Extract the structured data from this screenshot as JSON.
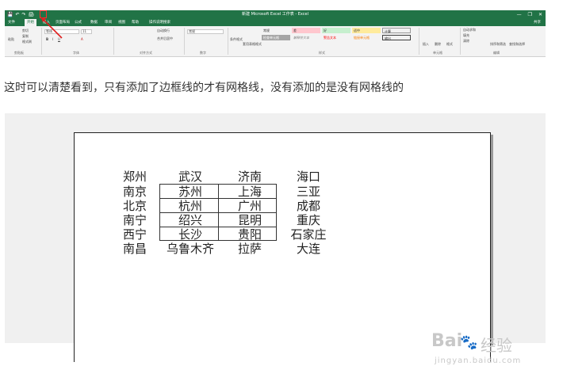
{
  "excel": {
    "window_title": "新建 Microsoft Excel 工作表 - Excel",
    "qat": {
      "save_icon": "💾",
      "undo_icon": "↶",
      "redo_icon": "↷",
      "print_preview_icon": "🖨"
    },
    "window_controls": [
      "—",
      "❐",
      "✕"
    ],
    "tabs": [
      "文件",
      "开始",
      "插入",
      "页面布局",
      "公式",
      "数据",
      "审阅",
      "视图",
      "帮助",
      "操作说明搜索"
    ],
    "active_tab_index": 1,
    "share": "共享",
    "groups": {
      "clipboard": {
        "label": "剪贴板",
        "paste": "粘贴",
        "cut": "剪切",
        "copy": "复制",
        "format_painter": "格式刷"
      },
      "font": {
        "label": "字体",
        "font_name": "等线",
        "font_size": "11"
      },
      "alignment": {
        "label": "对齐方式",
        "wrap": "自动换行",
        "merge": "合并后居中"
      },
      "number": {
        "label": "数字",
        "format": "常规"
      },
      "styles": {
        "label": "样式",
        "conditional": "条件格式",
        "table_format": "套用表格格式",
        "cells": [
          {
            "text": "常规",
            "bg": "#ffffff"
          },
          {
            "text": "差",
            "bg": "#ffc7ce"
          },
          {
            "text": "好",
            "bg": "#c6efce"
          },
          {
            "text": "适中",
            "bg": "#ffeb9c"
          },
          {
            "text": "计算",
            "bg": "#f2f2f2"
          },
          {
            "text": "检查单元格",
            "bg": "#a5a5a5"
          },
          {
            "text": "解释性文本",
            "bg": "#ffffff"
          },
          {
            "text": "警告文本",
            "bg": "#ffffff"
          },
          {
            "text": "链接单元格",
            "bg": "#ffffff"
          },
          {
            "text": "输出",
            "bg": "#f2f2f2"
          }
        ]
      },
      "cells": {
        "label": "单元格",
        "insert": "插入",
        "delete": "删除",
        "format": "格式"
      },
      "editing": {
        "label": "编辑",
        "autosum": "自动求和",
        "fill": "填充",
        "clear": "清除",
        "sort": "排序和筛选",
        "find": "查找和选择"
      }
    },
    "accent": "#217346"
  },
  "instruction": "这时可以清楚看到，只有添加了边框线的才有网格线，没有添加的是没有网格线的",
  "preview": {
    "rows": [
      [
        "郑州",
        "武汉",
        "济南",
        "海口"
      ],
      [
        "南京",
        "苏州",
        "上海",
        "三亚"
      ],
      [
        "北京",
        "杭州",
        "广州",
        "成都"
      ],
      [
        "南宁",
        "绍兴",
        "昆明",
        "重庆"
      ],
      [
        "西宁",
        "长沙",
        "贵阳",
        "石家庄"
      ],
      [
        "南昌",
        "乌鲁木齐",
        "拉萨",
        "大连"
      ]
    ]
  },
  "watermark": {
    "logo": "Bai",
    "paw": "🐾",
    "cn": "经验",
    "url": "jingyan.baidu.com"
  }
}
